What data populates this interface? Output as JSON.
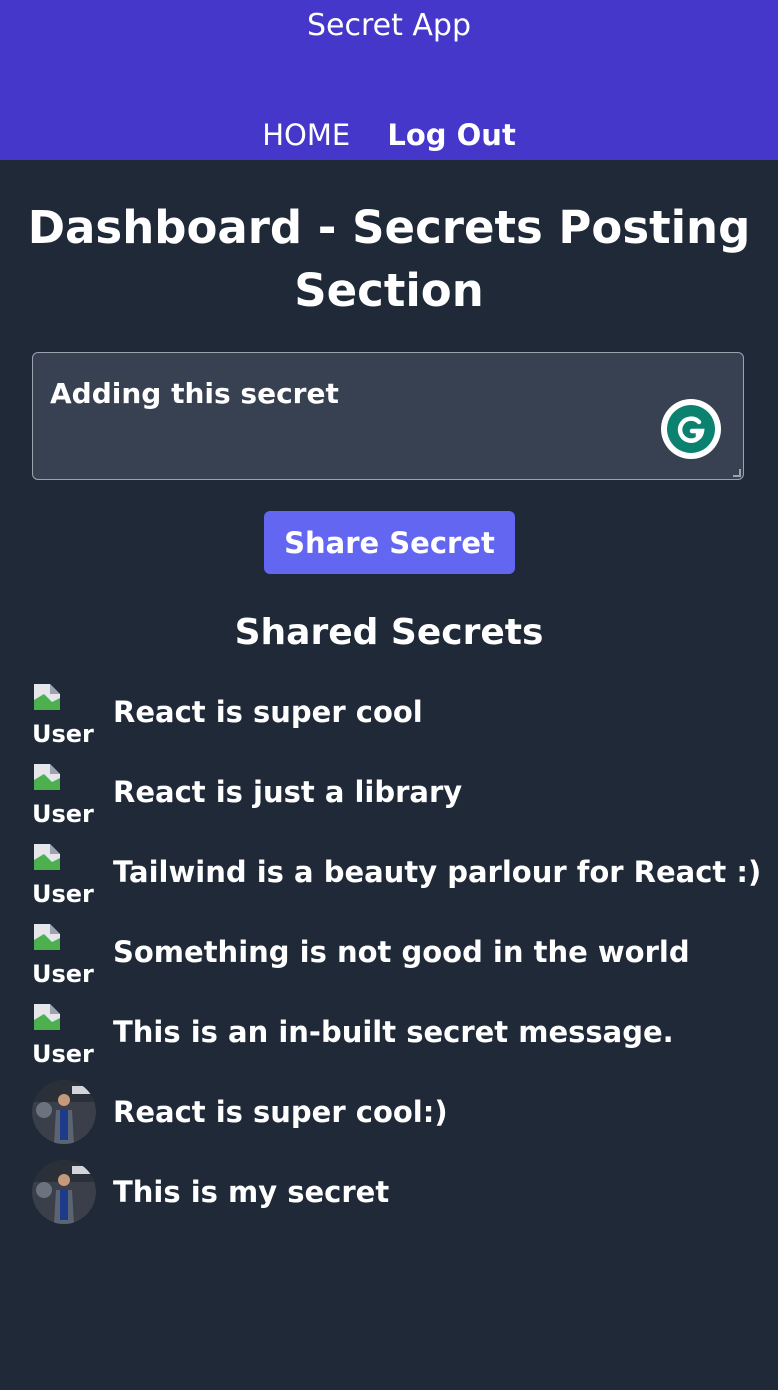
{
  "header": {
    "app_title": "Secret App",
    "nav": {
      "home": "HOME",
      "logout": "Log Out"
    }
  },
  "dashboard": {
    "title": "Dashboard - Secrets Posting Section",
    "input_value": "Adding this secret",
    "share_label": "Share Secret",
    "shared_heading": "Shared Secrets"
  },
  "secrets": [
    {
      "text": "React is super cool",
      "avatar": "broken-image-icon",
      "alt": "User"
    },
    {
      "text": "React is just a library",
      "avatar": "broken-image-icon",
      "alt": "User"
    },
    {
      "text": "Tailwind is a beauty parlour for React :)",
      "avatar": "broken-image-icon",
      "alt": "User"
    },
    {
      "text": "Something is not good in the world",
      "avatar": "broken-image-icon",
      "alt": "User"
    },
    {
      "text": "This is an in-built secret message.",
      "avatar": "broken-image-icon",
      "alt": "User"
    },
    {
      "text": "React is super cool:)",
      "avatar": "user-photo"
    },
    {
      "text": "This is my secret",
      "avatar": "user-photo"
    }
  ],
  "colors": {
    "header_bg": "#4437c9",
    "page_bg": "#1f2937",
    "input_bg": "#374151",
    "button_bg": "#6366f1",
    "grammarly": "#0b8170"
  }
}
